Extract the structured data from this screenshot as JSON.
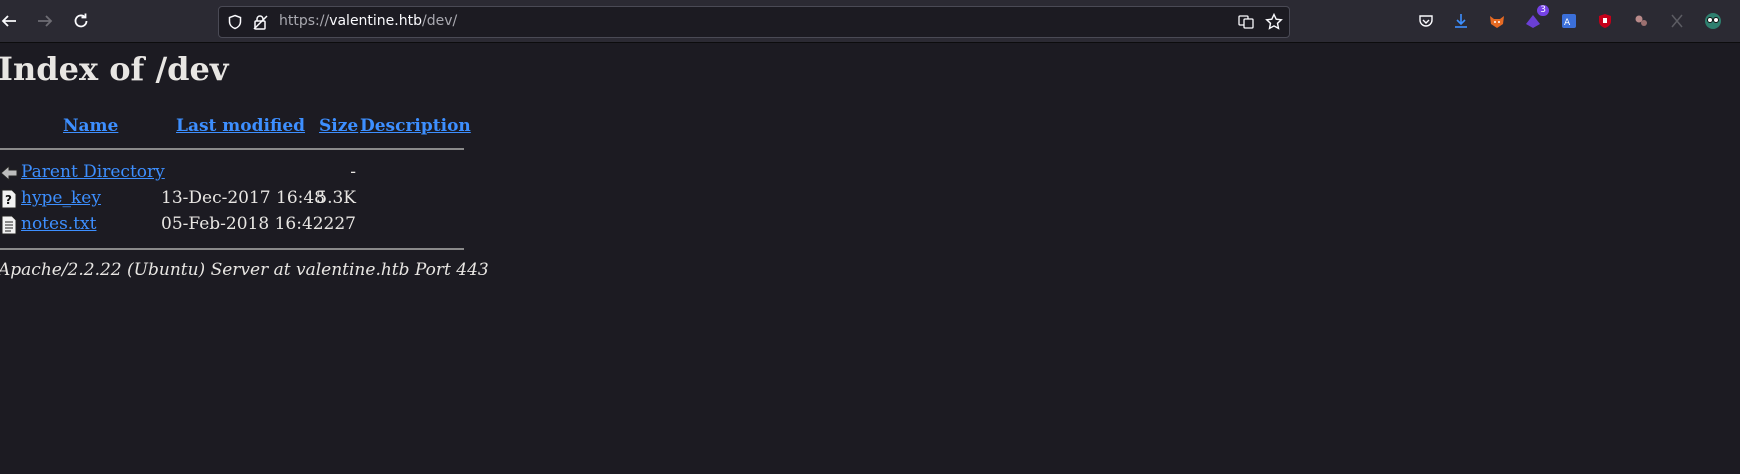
{
  "browser": {
    "url_prefix": "https://",
    "url_host": "valentine.htb",
    "url_path": "/dev/",
    "extension_badge": "3"
  },
  "page": {
    "title": "Index of /dev",
    "columns": {
      "name": "Name",
      "last_modified": "Last modified",
      "size": "Size",
      "description": "Description"
    },
    "rows": [
      {
        "name": "Parent Directory",
        "modified": "",
        "size": "-",
        "icon": "back-icon"
      },
      {
        "name": "hype_key",
        "modified": "13-Dec-2017 16:48",
        "size": "5.3K",
        "icon": "unknown-file-icon"
      },
      {
        "name": "notes.txt",
        "modified": "05-Feb-2018 16:42",
        "size": "227",
        "icon": "text-file-icon"
      }
    ],
    "footer": "Apache/2.2.22 (Ubuntu) Server at valentine.htb Port 443"
  },
  "colors": {
    "page_background": "#1c1b22",
    "link": "#3d8fff",
    "toolbar": "#2b2a33"
  }
}
